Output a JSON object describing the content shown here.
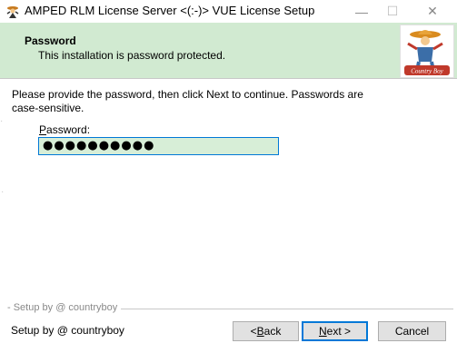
{
  "window": {
    "title": "AMPED RLM License Server <(:-)> VUE License Setup",
    "minimize_glyph": "—",
    "maximize_glyph": "☐",
    "close_glyph": "✕"
  },
  "header": {
    "title": "Password",
    "subtitle": "This installation is password protected."
  },
  "logo": {
    "text": "Country Boy"
  },
  "main": {
    "instructions": "Please provide the password, then click Next to continue. Passwords are case-sensitive.",
    "password_label_accel": "P",
    "password_label_rest": "assword:",
    "password_value": "●●●●●●●●●●"
  },
  "footer": {
    "separator_label": "- Setup by @ countryboy",
    "text": "Setup by @ countryboy",
    "back_prefix": "< ",
    "back_accel": "B",
    "back_rest": "ack",
    "next_accel": "N",
    "next_rest": "ext >",
    "cancel_label": "Cancel"
  },
  "colors": {
    "header_bg": "#d1ead1",
    "input_bg": "#d7eed7",
    "focus_border": "#0078d7"
  },
  "icons": {
    "app": "cowboy-app-icon",
    "logo": "country-boy-logo"
  }
}
